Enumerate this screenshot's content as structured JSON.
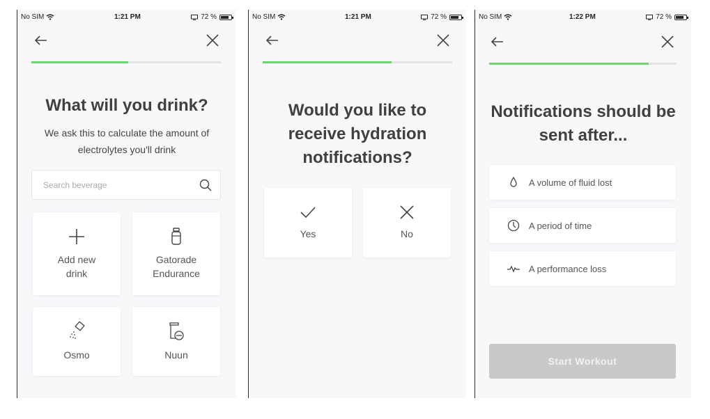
{
  "status_bar": {
    "carrier": "No SIM",
    "battery": "72 %"
  },
  "screen1": {
    "time": "1:21 PM",
    "progress": 0.51,
    "title": "What will you drink?",
    "subtitle": "We ask this to calculate the amount of electrolytes you'll drink",
    "search": {
      "placeholder": "Search beverage"
    },
    "tiles": [
      {
        "label": "Add new\ndrink",
        "icon": "plus-icon"
      },
      {
        "label": "Gatorade\nEndurance",
        "icon": "bottle-icon"
      },
      {
        "label": "Osmo",
        "icon": "powder-packet-icon"
      },
      {
        "label": "Nuun",
        "icon": "tablet-tube-icon"
      }
    ]
  },
  "screen2": {
    "time": "1:21 PM",
    "progress": 0.68,
    "title": "Would you like to receive hydration notifications?",
    "options": [
      {
        "label": "Yes",
        "icon": "check-icon"
      },
      {
        "label": "No",
        "icon": "close-icon"
      }
    ]
  },
  "screen3": {
    "time": "1:22 PM",
    "progress": 0.85,
    "title": "Notifications should be sent after...",
    "options": [
      {
        "label": "A volume of fluid lost",
        "icon": "droplet-icon"
      },
      {
        "label": "A period of time",
        "icon": "clock-icon"
      },
      {
        "label": "A performance loss",
        "icon": "pulse-icon"
      }
    ],
    "start_button": "Start Workout",
    "button_color": "#c9c9cb"
  },
  "colors": {
    "progress_fill": "#6dd56d",
    "progress_track": "#e3e3e6",
    "background": "#f8f7fa"
  }
}
